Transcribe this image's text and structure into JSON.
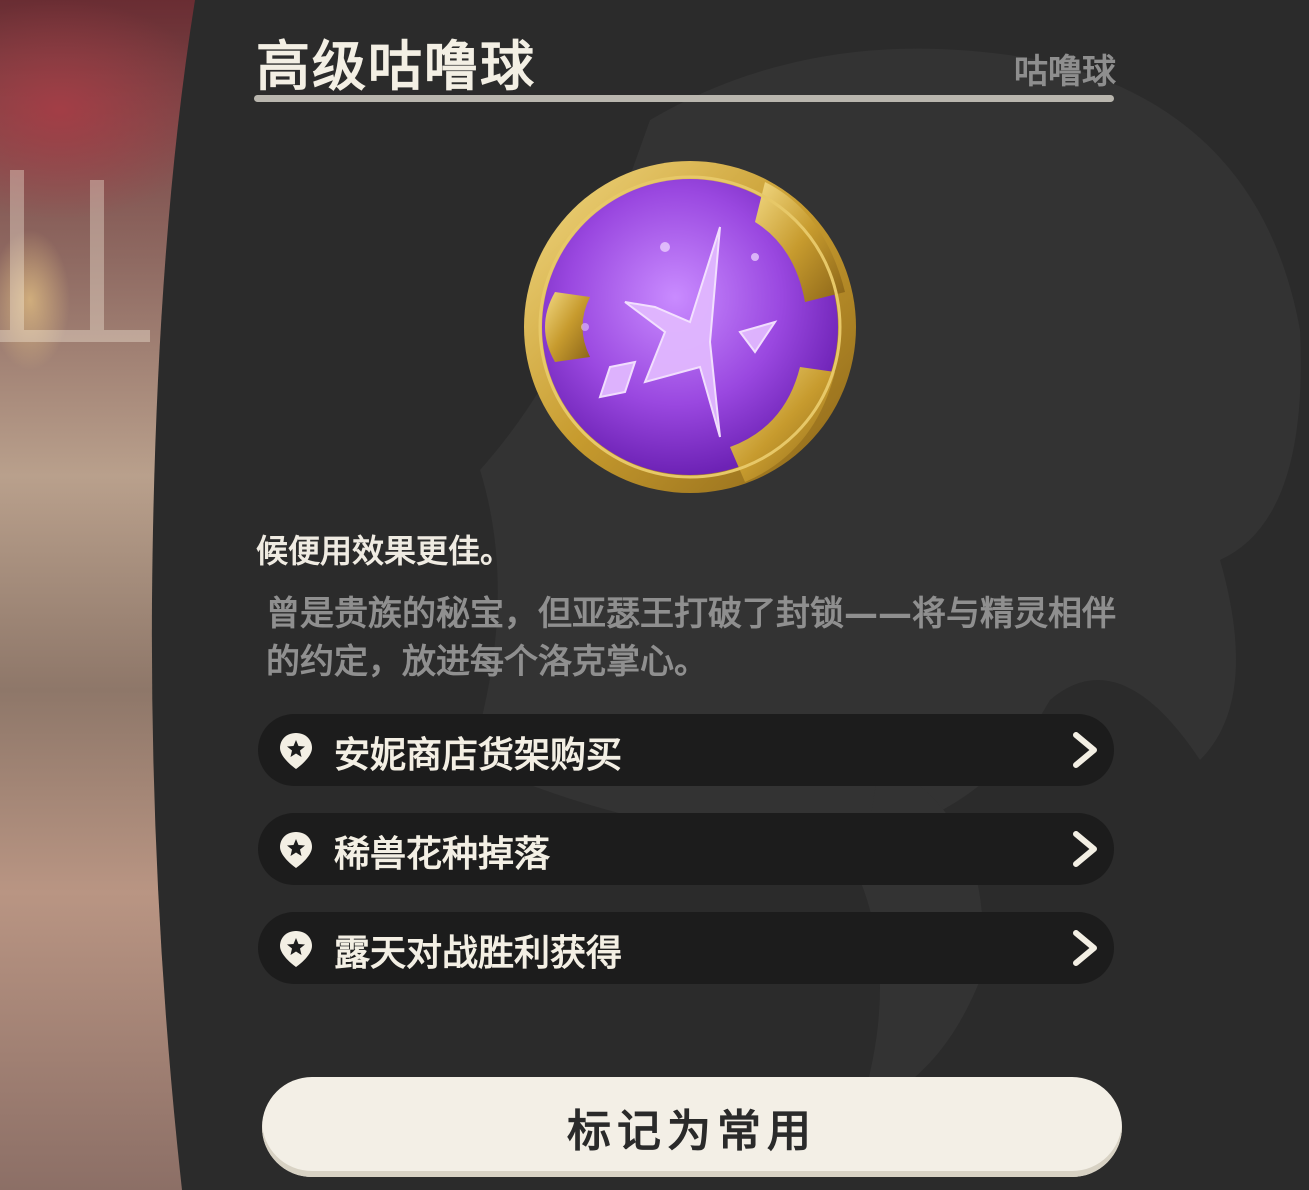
{
  "item": {
    "name": "高级咕噜球",
    "category": "咕噜球",
    "effect_text": "候便用效果更佳。",
    "lore_text": "曾是贵族的秘宝，但亚瑟王打破了封锁——将与精灵相伴的约定，放进每个洛克掌心。",
    "icon": "purple-crystal-orb-icon"
  },
  "sources": [
    {
      "label": "安妮商店货架购买",
      "icon": "map-pin-icon",
      "action_icon": "chevron-right-icon"
    },
    {
      "label": "稀兽花种掉落",
      "icon": "map-pin-icon",
      "action_icon": "chevron-right-icon"
    },
    {
      "label": "露天对战胜利获得",
      "icon": "map-pin-icon",
      "action_icon": "chevron-right-icon"
    }
  ],
  "actions": {
    "mark_favorite_label": "标记为常用"
  },
  "colors": {
    "panel": "#2b2b2b",
    "source_row": "#1c1c1c",
    "title_text": "#f3efe4",
    "muted_text": "#8f8f8f",
    "button_bg": "#f3efe6",
    "orb_purple": "#a65ae6",
    "orb_gold": "#c9a336"
  }
}
